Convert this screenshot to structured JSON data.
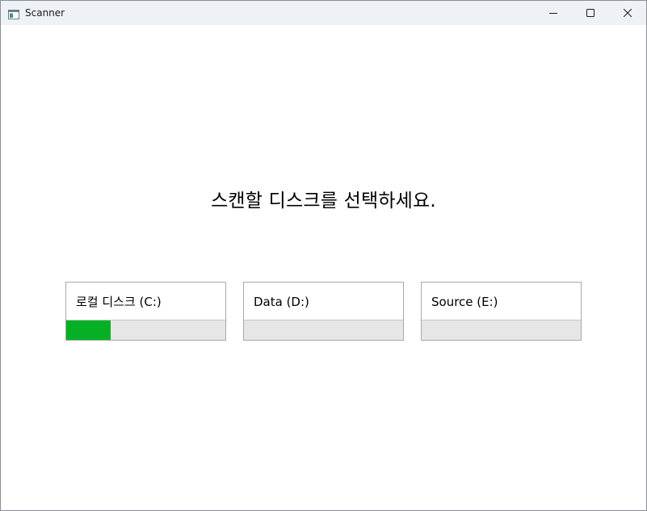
{
  "window": {
    "title": "Scanner",
    "icon": "app-window-icon",
    "controls": {
      "minimize": "minimize-icon",
      "maximize": "maximize-icon",
      "close": "close-icon"
    }
  },
  "main": {
    "heading": "스캔할 디스크를 선택하세요."
  },
  "disks": [
    {
      "label": "로컬 디스크 (C:)",
      "usage_fraction": 0.28
    },
    {
      "label": "Data (D:)",
      "usage_fraction": 0
    },
    {
      "label": "Source (E:)",
      "usage_fraction": 0
    }
  ],
  "colors": {
    "usage_fill": "#06b025",
    "usage_track": "#e6e6e6",
    "card_border": "#a9a9a9",
    "titlebar": "#eef2f7"
  }
}
